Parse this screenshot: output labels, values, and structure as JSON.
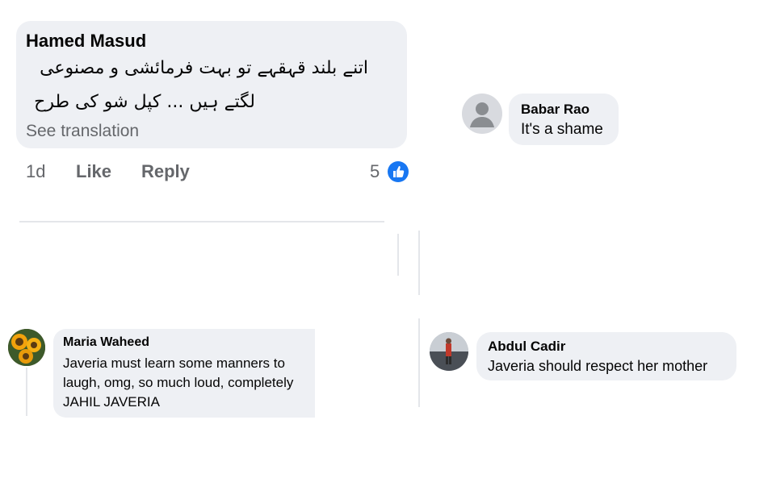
{
  "comments": {
    "hamed": {
      "author": "Hamed Masud",
      "text_line1": "اتنے بلند قہقہے تو بہت فرمائشی و مصنوعی",
      "text_line2": "لگتے ہیں ... کپل شو کی طرح",
      "see_translation": "See translation",
      "time": "1d",
      "like_label": "Like",
      "reply_label": "Reply",
      "reaction_count": "5",
      "reaction_icon": "like-reaction-icon",
      "reaction_color": "#1877f2"
    },
    "babar": {
      "author": "Babar Rao",
      "text": "It's a shame",
      "avatar": "default-user-avatar"
    },
    "maria": {
      "author": "Maria Waheed",
      "text_line1": "Javeria must learn some manners to",
      "text_line2": "laugh, omg, so much loud, completely",
      "text_line3": "JAHIL JAVERIA",
      "avatar": "sunflower-avatar"
    },
    "abdul": {
      "author": "Abdul Cadir",
      "text": "Javeria should respect her mother",
      "avatar": "person-photo-avatar"
    }
  },
  "colors": {
    "bubble": "#eef0f4",
    "secondary_text": "#65676b",
    "accent": "#1877f2"
  }
}
